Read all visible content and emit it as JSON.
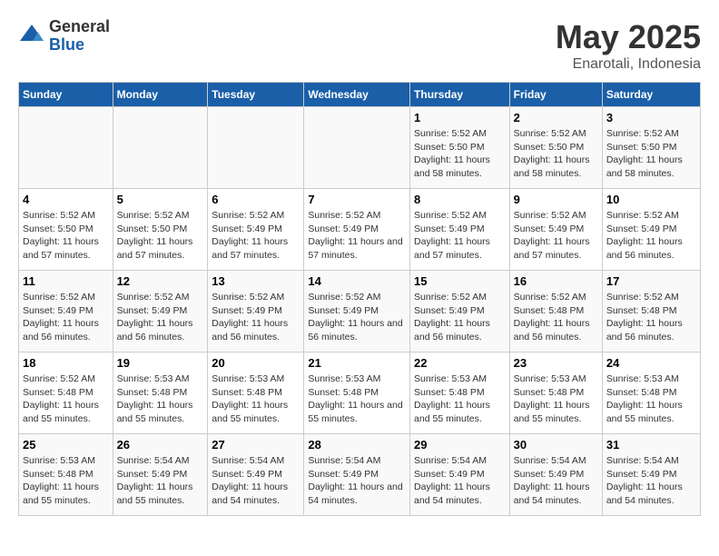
{
  "logo": {
    "general": "General",
    "blue": "Blue"
  },
  "title": "May 2025",
  "subtitle": "Enarotali, Indonesia",
  "days_of_week": [
    "Sunday",
    "Monday",
    "Tuesday",
    "Wednesday",
    "Thursday",
    "Friday",
    "Saturday"
  ],
  "weeks": [
    [
      {
        "day": "",
        "info": ""
      },
      {
        "day": "",
        "info": ""
      },
      {
        "day": "",
        "info": ""
      },
      {
        "day": "",
        "info": ""
      },
      {
        "day": "1",
        "info": "Sunrise: 5:52 AM\nSunset: 5:50 PM\nDaylight: 11 hours and 58 minutes."
      },
      {
        "day": "2",
        "info": "Sunrise: 5:52 AM\nSunset: 5:50 PM\nDaylight: 11 hours and 58 minutes."
      },
      {
        "day": "3",
        "info": "Sunrise: 5:52 AM\nSunset: 5:50 PM\nDaylight: 11 hours and 58 minutes."
      }
    ],
    [
      {
        "day": "4",
        "info": "Sunrise: 5:52 AM\nSunset: 5:50 PM\nDaylight: 11 hours and 57 minutes."
      },
      {
        "day": "5",
        "info": "Sunrise: 5:52 AM\nSunset: 5:50 PM\nDaylight: 11 hours and 57 minutes."
      },
      {
        "day": "6",
        "info": "Sunrise: 5:52 AM\nSunset: 5:49 PM\nDaylight: 11 hours and 57 minutes."
      },
      {
        "day": "7",
        "info": "Sunrise: 5:52 AM\nSunset: 5:49 PM\nDaylight: 11 hours and 57 minutes."
      },
      {
        "day": "8",
        "info": "Sunrise: 5:52 AM\nSunset: 5:49 PM\nDaylight: 11 hours and 57 minutes."
      },
      {
        "day": "9",
        "info": "Sunrise: 5:52 AM\nSunset: 5:49 PM\nDaylight: 11 hours and 57 minutes."
      },
      {
        "day": "10",
        "info": "Sunrise: 5:52 AM\nSunset: 5:49 PM\nDaylight: 11 hours and 56 minutes."
      }
    ],
    [
      {
        "day": "11",
        "info": "Sunrise: 5:52 AM\nSunset: 5:49 PM\nDaylight: 11 hours and 56 minutes."
      },
      {
        "day": "12",
        "info": "Sunrise: 5:52 AM\nSunset: 5:49 PM\nDaylight: 11 hours and 56 minutes."
      },
      {
        "day": "13",
        "info": "Sunrise: 5:52 AM\nSunset: 5:49 PM\nDaylight: 11 hours and 56 minutes."
      },
      {
        "day": "14",
        "info": "Sunrise: 5:52 AM\nSunset: 5:49 PM\nDaylight: 11 hours and 56 minutes."
      },
      {
        "day": "15",
        "info": "Sunrise: 5:52 AM\nSunset: 5:49 PM\nDaylight: 11 hours and 56 minutes."
      },
      {
        "day": "16",
        "info": "Sunrise: 5:52 AM\nSunset: 5:48 PM\nDaylight: 11 hours and 56 minutes."
      },
      {
        "day": "17",
        "info": "Sunrise: 5:52 AM\nSunset: 5:48 PM\nDaylight: 11 hours and 56 minutes."
      }
    ],
    [
      {
        "day": "18",
        "info": "Sunrise: 5:52 AM\nSunset: 5:48 PM\nDaylight: 11 hours and 55 minutes."
      },
      {
        "day": "19",
        "info": "Sunrise: 5:53 AM\nSunset: 5:48 PM\nDaylight: 11 hours and 55 minutes."
      },
      {
        "day": "20",
        "info": "Sunrise: 5:53 AM\nSunset: 5:48 PM\nDaylight: 11 hours and 55 minutes."
      },
      {
        "day": "21",
        "info": "Sunrise: 5:53 AM\nSunset: 5:48 PM\nDaylight: 11 hours and 55 minutes."
      },
      {
        "day": "22",
        "info": "Sunrise: 5:53 AM\nSunset: 5:48 PM\nDaylight: 11 hours and 55 minutes."
      },
      {
        "day": "23",
        "info": "Sunrise: 5:53 AM\nSunset: 5:48 PM\nDaylight: 11 hours and 55 minutes."
      },
      {
        "day": "24",
        "info": "Sunrise: 5:53 AM\nSunset: 5:48 PM\nDaylight: 11 hours and 55 minutes."
      }
    ],
    [
      {
        "day": "25",
        "info": "Sunrise: 5:53 AM\nSunset: 5:48 PM\nDaylight: 11 hours and 55 minutes."
      },
      {
        "day": "26",
        "info": "Sunrise: 5:54 AM\nSunset: 5:49 PM\nDaylight: 11 hours and 55 minutes."
      },
      {
        "day": "27",
        "info": "Sunrise: 5:54 AM\nSunset: 5:49 PM\nDaylight: 11 hours and 54 minutes."
      },
      {
        "day": "28",
        "info": "Sunrise: 5:54 AM\nSunset: 5:49 PM\nDaylight: 11 hours and 54 minutes."
      },
      {
        "day": "29",
        "info": "Sunrise: 5:54 AM\nSunset: 5:49 PM\nDaylight: 11 hours and 54 minutes."
      },
      {
        "day": "30",
        "info": "Sunrise: 5:54 AM\nSunset: 5:49 PM\nDaylight: 11 hours and 54 minutes."
      },
      {
        "day": "31",
        "info": "Sunrise: 5:54 AM\nSunset: 5:49 PM\nDaylight: 11 hours and 54 minutes."
      }
    ]
  ]
}
